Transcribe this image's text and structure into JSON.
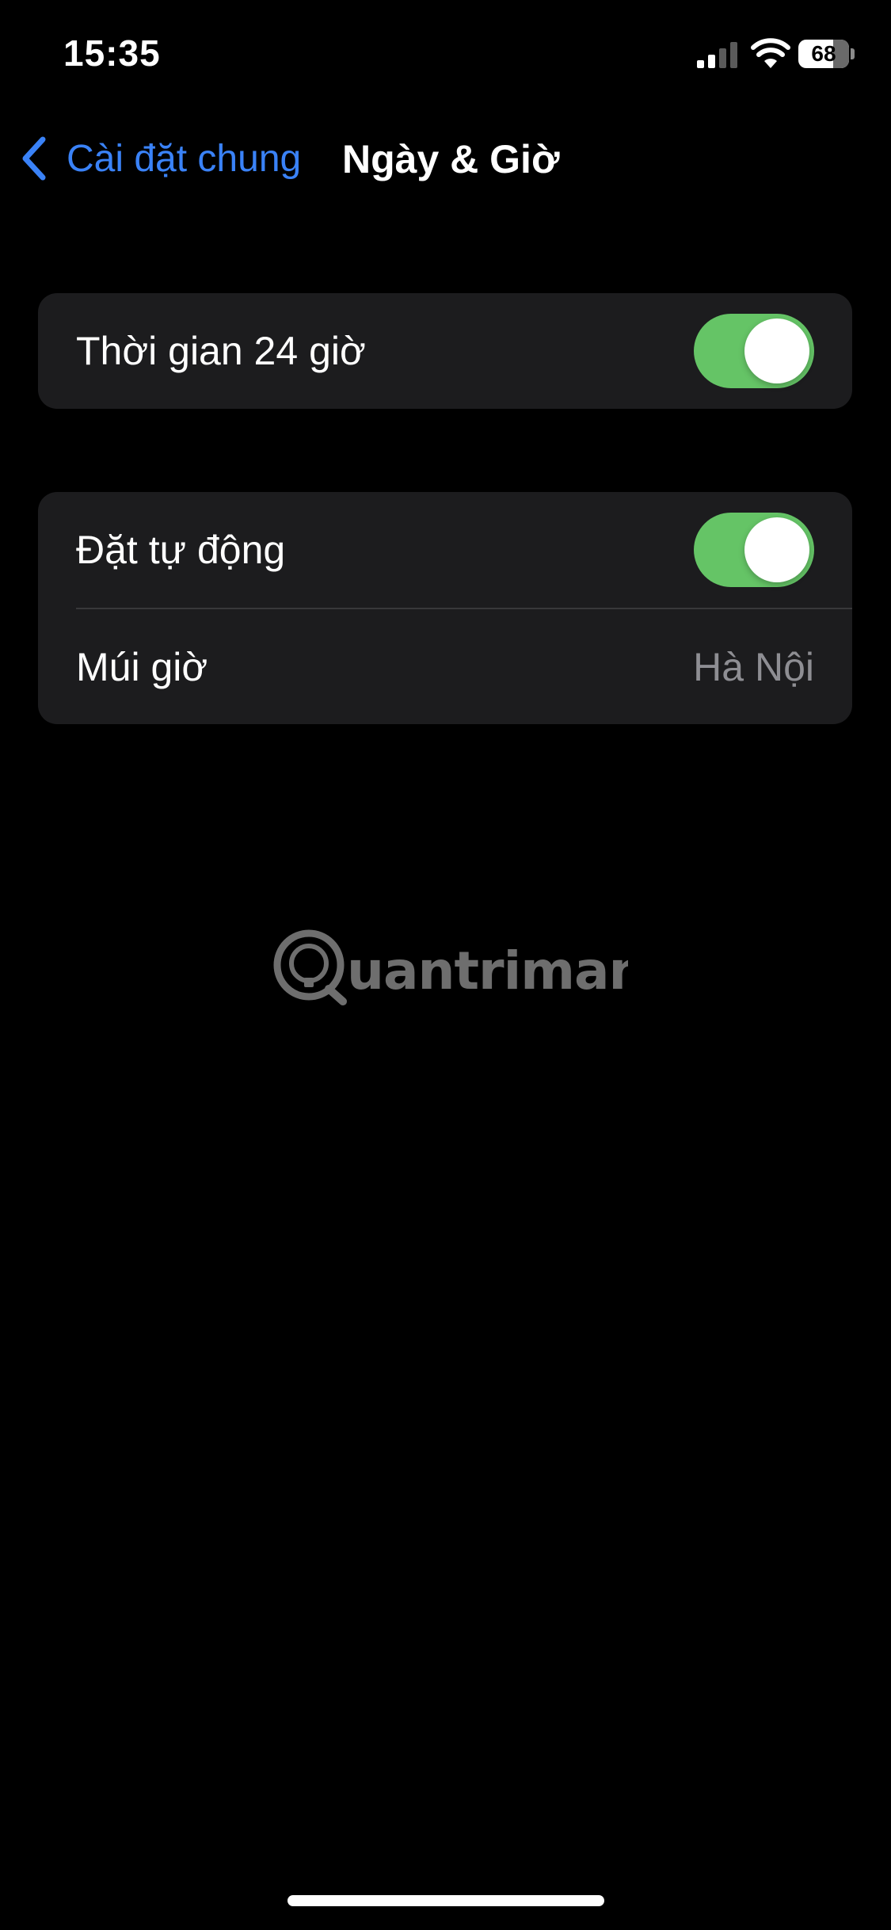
{
  "status_bar": {
    "time": "15:35",
    "battery_level": "68",
    "battery_fraction": 0.68,
    "icons": [
      "cellular-signal-icon",
      "wifi-icon",
      "battery-icon"
    ]
  },
  "nav": {
    "back_label": "Cài đặt chung",
    "title": "Ngày & Giờ",
    "back_icon": "chevron-left-icon"
  },
  "settings": {
    "time_24h": {
      "label": "Thời gian 24 giờ",
      "enabled": true
    },
    "set_automatically": {
      "label": "Đặt tự động",
      "enabled": true
    },
    "time_zone": {
      "label": "Múi giờ",
      "value": "Hà Nội"
    }
  },
  "watermark": {
    "text": "Quantrimang"
  },
  "colors": {
    "background": "#000000",
    "group_background": "#1c1c1e",
    "accent_blue": "#3a82f7",
    "toggle_on": "#65c466",
    "secondary_text": "#8e8e93",
    "separator": "#38383a"
  }
}
